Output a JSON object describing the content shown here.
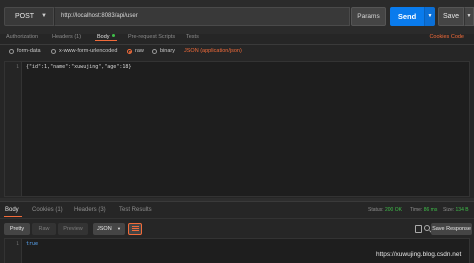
{
  "request": {
    "method": "POST",
    "url": "http://localhost:8083/api/user",
    "params_label": "Params",
    "send_label": "Send",
    "save_label": "Save"
  },
  "request_tabs": {
    "authorization": "Authorization",
    "headers": "Headers (1)",
    "body": "Body",
    "prerequest": "Pre-request Scripts",
    "tests": "Tests",
    "cookies": "Cookies",
    "code": "Code"
  },
  "body_types": {
    "form_data": "form-data",
    "urlencoded": "x-www-form-urlencoded",
    "raw": "raw",
    "binary": "binary",
    "content_type": "JSON (application/json)"
  },
  "request_body": {
    "line_number": "1",
    "code": "{\"id\":1,\"name\":\"xuwujing\",\"age\":18}"
  },
  "response_tabs": {
    "body": "Body",
    "cookies": "Cookies (1)",
    "headers": "Headers (3)",
    "test_results": "Test Results"
  },
  "response_meta": {
    "status_label": "Status:",
    "status_value": "200 OK",
    "time_label": "Time:",
    "time_value": "86 ms",
    "size_label": "Size:",
    "size_value": "134 B"
  },
  "response_tools": {
    "pretty": "Pretty",
    "raw": "Raw",
    "preview": "Preview",
    "format": "JSON",
    "save_response": "Save Response"
  },
  "response_body": {
    "line_number": "1",
    "code": "true"
  },
  "watermark": "https://xuwujing.blog.csdn.net",
  "colors": {
    "accent": "#f26b3a",
    "send": "#097bed",
    "status_ok": "#3fbf4a"
  }
}
